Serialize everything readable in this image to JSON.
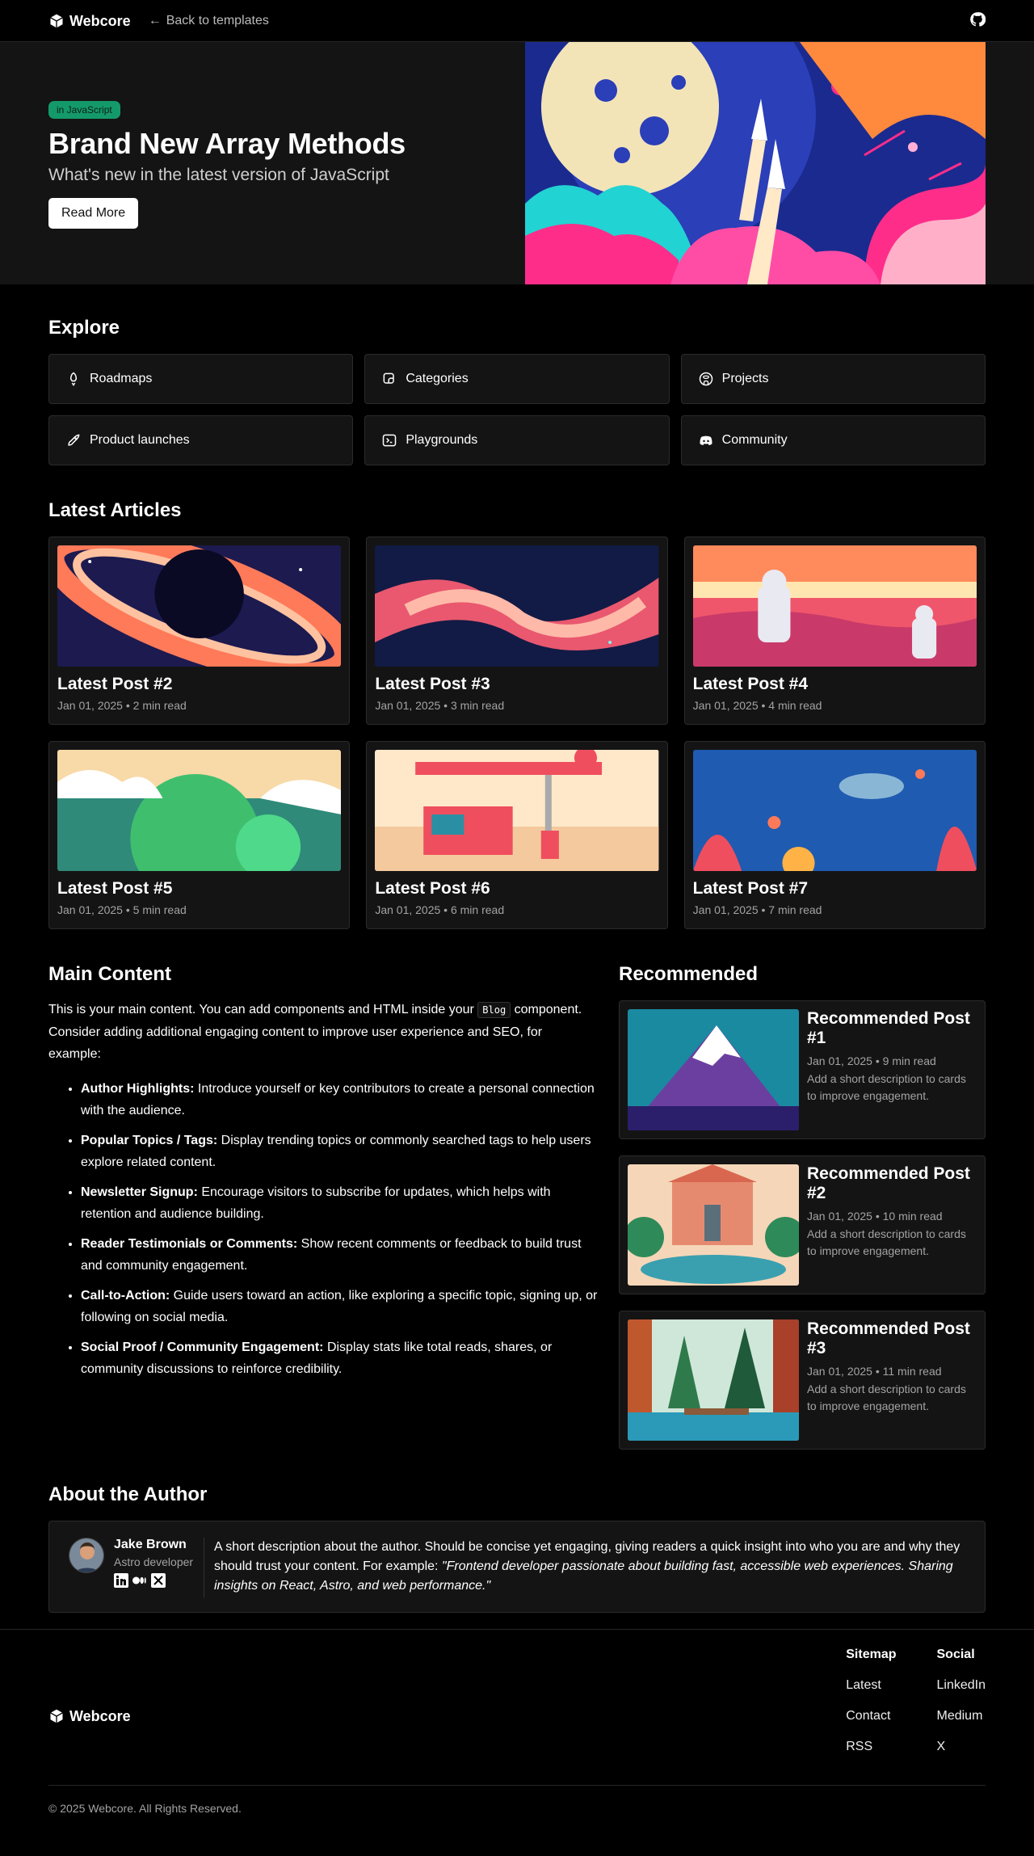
{
  "header": {
    "brand": "Webcore",
    "back_label": "Back to templates"
  },
  "hero": {
    "badge": "in JavaScript",
    "title": "Brand New Array Methods",
    "subtitle": "What's new in the latest version of JavaScript",
    "button": "Read More"
  },
  "explore": {
    "title": "Explore",
    "items": [
      {
        "label": "Roadmaps",
        "icon": "rocket-launch-icon"
      },
      {
        "label": "Categories",
        "icon": "stickers-icon"
      },
      {
        "label": "Projects",
        "icon": "github-icon"
      },
      {
        "label": "Product launches",
        "icon": "rocket-icon"
      },
      {
        "label": "Playgrounds",
        "icon": "terminal-icon"
      },
      {
        "label": "Community",
        "icon": "discord-icon"
      }
    ]
  },
  "latest": {
    "title": "Latest Articles",
    "posts": [
      {
        "title": "Latest Post #2",
        "meta": "Jan 01, 2025 • 2 min read"
      },
      {
        "title": "Latest Post #3",
        "meta": "Jan 01, 2025 • 3 min read"
      },
      {
        "title": "Latest Post #4",
        "meta": "Jan 01, 2025 • 4 min read"
      },
      {
        "title": "Latest Post #5",
        "meta": "Jan 01, 2025 • 5 min read"
      },
      {
        "title": "Latest Post #6",
        "meta": "Jan 01, 2025 • 6 min read"
      },
      {
        "title": "Latest Post #7",
        "meta": "Jan 01, 2025 • 7 min read"
      }
    ]
  },
  "main": {
    "title": "Main Content",
    "intro_before": "This is your main content. You can add components and HTML inside your",
    "intro_code": "Blog",
    "intro_after": "component. Consider adding additional engaging content to improve user experience and SEO, for example:",
    "items": [
      {
        "bold": "Author Highlights:",
        "text": "Introduce yourself or key contributors to create a personal connection with the audience."
      },
      {
        "bold": "Popular Topics / Tags:",
        "text": "Display trending topics or commonly searched tags to help users explore related content."
      },
      {
        "bold": "Newsletter Signup:",
        "text": "Encourage visitors to subscribe for updates, which helps with retention and audience building."
      },
      {
        "bold": "Reader Testimonials or Comments:",
        "text": "Show recent comments or feedback to build trust and community engagement."
      },
      {
        "bold": "Call-to-Action:",
        "text": "Guide users toward an action, like exploring a specific topic, signing up, or following on social media."
      },
      {
        "bold": "Social Proof / Community Engagement:",
        "text": "Display stats like total reads, shares, or community discussions to reinforce credibility."
      }
    ]
  },
  "recommended": {
    "title": "Recommended",
    "posts": [
      {
        "title": "Recommended Post #1",
        "meta": "Jan 01, 2025 • 9 min read",
        "desc": "Add a short description to cards to improve engagement."
      },
      {
        "title": "Recommended Post #2",
        "meta": "Jan 01, 2025 • 10 min read",
        "desc": "Add a short description to cards to improve engagement."
      },
      {
        "title": "Recommended Post #3",
        "meta": "Jan 01, 2025 • 11 min read",
        "desc": "Add a short description to cards to improve engagement."
      }
    ]
  },
  "about": {
    "title": "About the Author",
    "name": "Jake Brown",
    "role": "Astro developer",
    "text": "A short description about the author. Should be concise yet engaging, giving readers a quick insight into who you are and why they should trust your content. For example:",
    "quote": "\"Frontend developer passionate about building fast, accessible web experiences. Sharing insights on React, Astro, and web performance.\""
  },
  "footer": {
    "brand": "Webcore",
    "sitemap_title": "Sitemap",
    "sitemap": [
      "Latest",
      "Contact",
      "RSS"
    ],
    "social_title": "Social",
    "social": [
      "LinkedIn",
      "Medium",
      "X"
    ],
    "copyright": "© 2025 Webcore. All Rights Reserved."
  },
  "colors": {
    "background": "#000000",
    "surface": "#141414",
    "border": "#2b2b2b",
    "badge": "#149a6a",
    "muted_text": "#a3a3a3"
  }
}
